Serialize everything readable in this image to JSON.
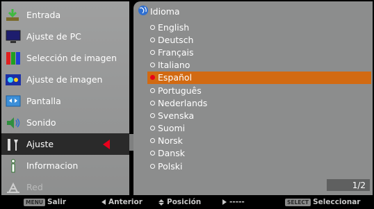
{
  "left_menu": {
    "items": [
      {
        "label": "Entrada",
        "icon": "input-icon"
      },
      {
        "label": "Ajuste de PC",
        "icon": "pc-adjust-icon"
      },
      {
        "label": "Selección de imagen",
        "icon": "image-select-icon"
      },
      {
        "label": "Ajuste de imagen",
        "icon": "image-adjust-icon"
      },
      {
        "label": "Pantalla",
        "icon": "screen-icon"
      },
      {
        "label": "Sonido",
        "icon": "sound-icon"
      },
      {
        "label": "Ajuste",
        "icon": "setting-icon",
        "selected": true
      },
      {
        "label": "Informacion",
        "icon": "info-icon"
      },
      {
        "label": "Red",
        "icon": "network-icon",
        "disabled": true
      }
    ]
  },
  "panel": {
    "title": "Idioma",
    "languages": [
      "English",
      "Deutsch",
      "Français",
      "Italiano",
      "Español",
      "Português",
      "Nederlands",
      "Svenska",
      "Suomi",
      "Norsk",
      "Dansk",
      "Polski"
    ],
    "selected_language": "Español",
    "page_indicator": "1/2"
  },
  "bottom_bar": {
    "menu_key": "MENU",
    "exit_label": "Salir",
    "previous_label": "Anterior",
    "position_label": "Posición",
    "next_label": "-----",
    "select_key": "SELECT",
    "select_label": "Seleccionar"
  },
  "colors": {
    "menu_bg": "#9fa0a0",
    "panel_bg": "#8c8d8d",
    "selected_menu_bg": "#2a2a2a",
    "highlight": "#d26a12",
    "accent_red": "#e8001c"
  }
}
